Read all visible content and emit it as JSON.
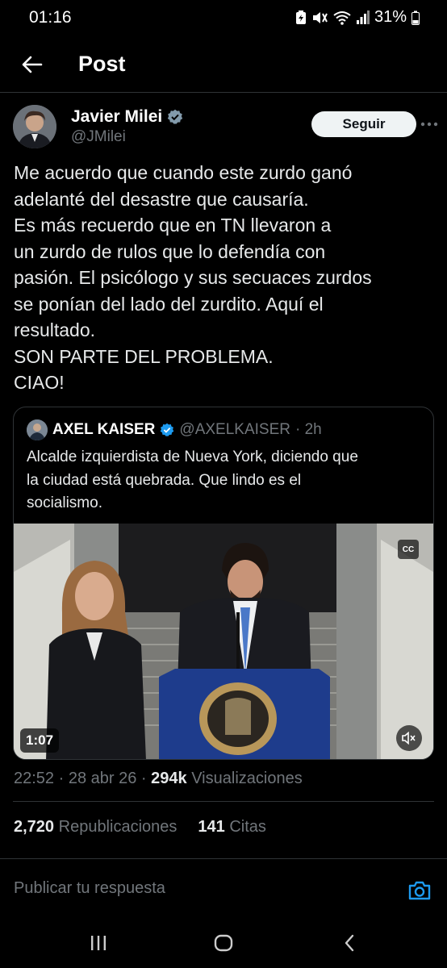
{
  "status_bar": {
    "time": "01:16",
    "battery": "31%"
  },
  "header": {
    "title": "Post"
  },
  "author": {
    "name": "Javier Milei",
    "handle": "@JMilei",
    "follow_label": "Seguir"
  },
  "post": {
    "lines": [
      "Me acuerdo que cuando este zurdo ganó",
      "adelanté del desastre que causaría.",
      "Es más recuerdo que en TN llevaron a",
      "un zurdo de rulos que lo defendía con",
      "pasión. El psicólogo y sus secuaces zurdos",
      "se ponían del lado del zurdito. Aquí el",
      "resultado.",
      "SON PARTE DEL PROBLEMA.",
      "CIAO!"
    ]
  },
  "quote": {
    "name": "AXEL KAISER",
    "handle": "@AXELKAISER",
    "time": "· 2h",
    "lines": [
      "Alcalde izquierdista de Nueva York, diciendo que",
      "la ciudad está quebrada. Que lindo es el",
      "socialismo."
    ],
    "video": {
      "cc_label": "CC",
      "duration": "1:07"
    }
  },
  "meta": {
    "time": "22:52",
    "date": "· 28 abr 26 ·",
    "views_count": "294k",
    "views_label": "Visualizaciones"
  },
  "stats": {
    "reposts_count": "2,720",
    "reposts_label": "Republicaciones",
    "quotes_count": "141",
    "quotes_label": "Citas"
  },
  "reply": {
    "placeholder": "Publicar tu respuesta"
  },
  "colors": {
    "background": "#000000",
    "accent": "#1d9bf0",
    "muted": "#71767b",
    "verified": "#1d9bf0"
  },
  "icons": [
    "back-arrow-icon",
    "verified-icon",
    "more-icon",
    "camera-icon",
    "mute-icon",
    "recents-icon",
    "home-icon",
    "back-icon"
  ]
}
